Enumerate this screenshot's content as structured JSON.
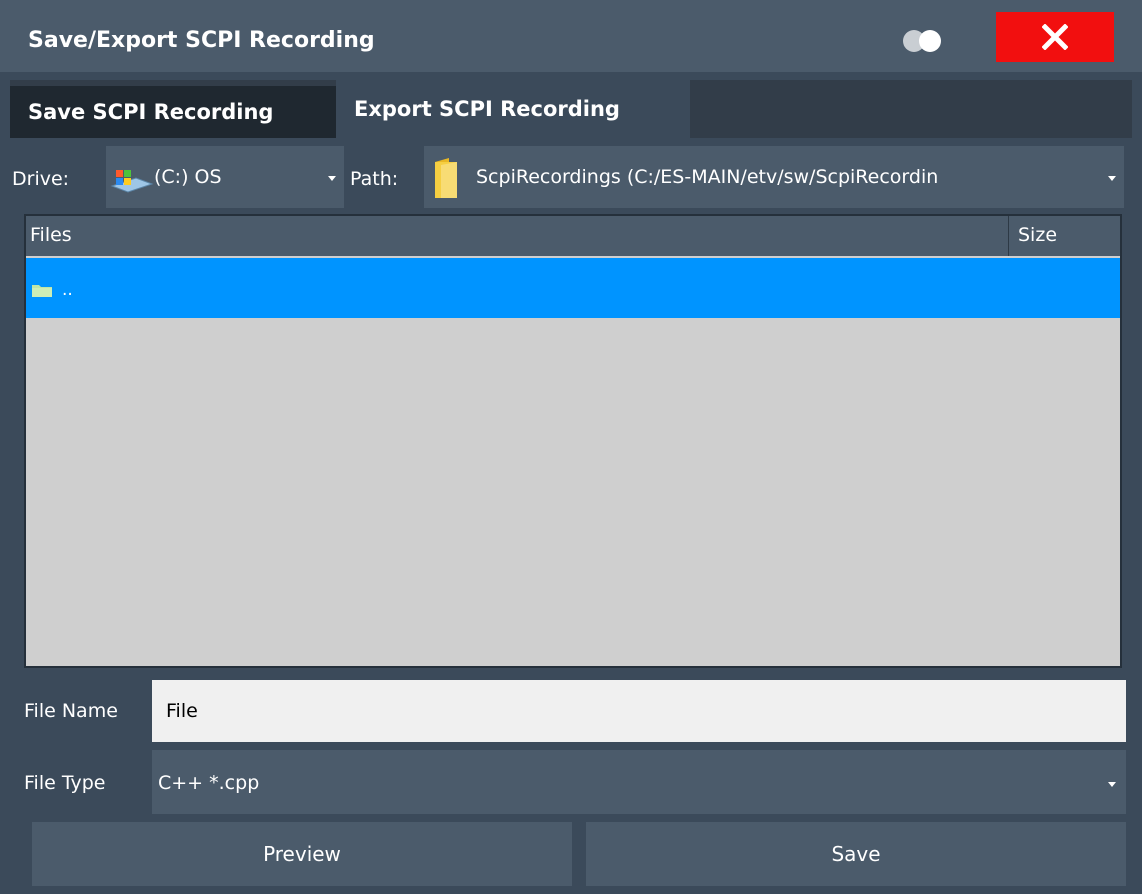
{
  "window": {
    "title": "Save/Export SCPI Recording"
  },
  "tabs": [
    {
      "label": "Save SCPI Recording",
      "active": false
    },
    {
      "label": "Export SCPI Recording",
      "active": true
    }
  ],
  "drive": {
    "label": "Drive:",
    "value": "(C:) OS"
  },
  "path": {
    "label": "Path:",
    "value": "ScpiRecordings (C:/ES-MAIN/etv/sw/ScpiRecordin"
  },
  "filelist": {
    "columns": [
      "Files",
      "Size"
    ],
    "rows": [
      {
        "name": "..",
        "size": "",
        "selected": true
      }
    ]
  },
  "file_name": {
    "label": "File Name",
    "value": "File"
  },
  "file_type": {
    "label": "File Type",
    "value": "C++ *.cpp"
  },
  "buttons": {
    "preview": "Preview",
    "save": "Save"
  },
  "colors": {
    "accent": "#0094ff",
    "close": "#f20f0f",
    "panel": "#3b4a5a",
    "header": "#4b5b6b"
  },
  "icons": [
    "toggle-icon",
    "close-icon",
    "drive-icon",
    "folder-icon",
    "chevron-down-icon"
  ]
}
